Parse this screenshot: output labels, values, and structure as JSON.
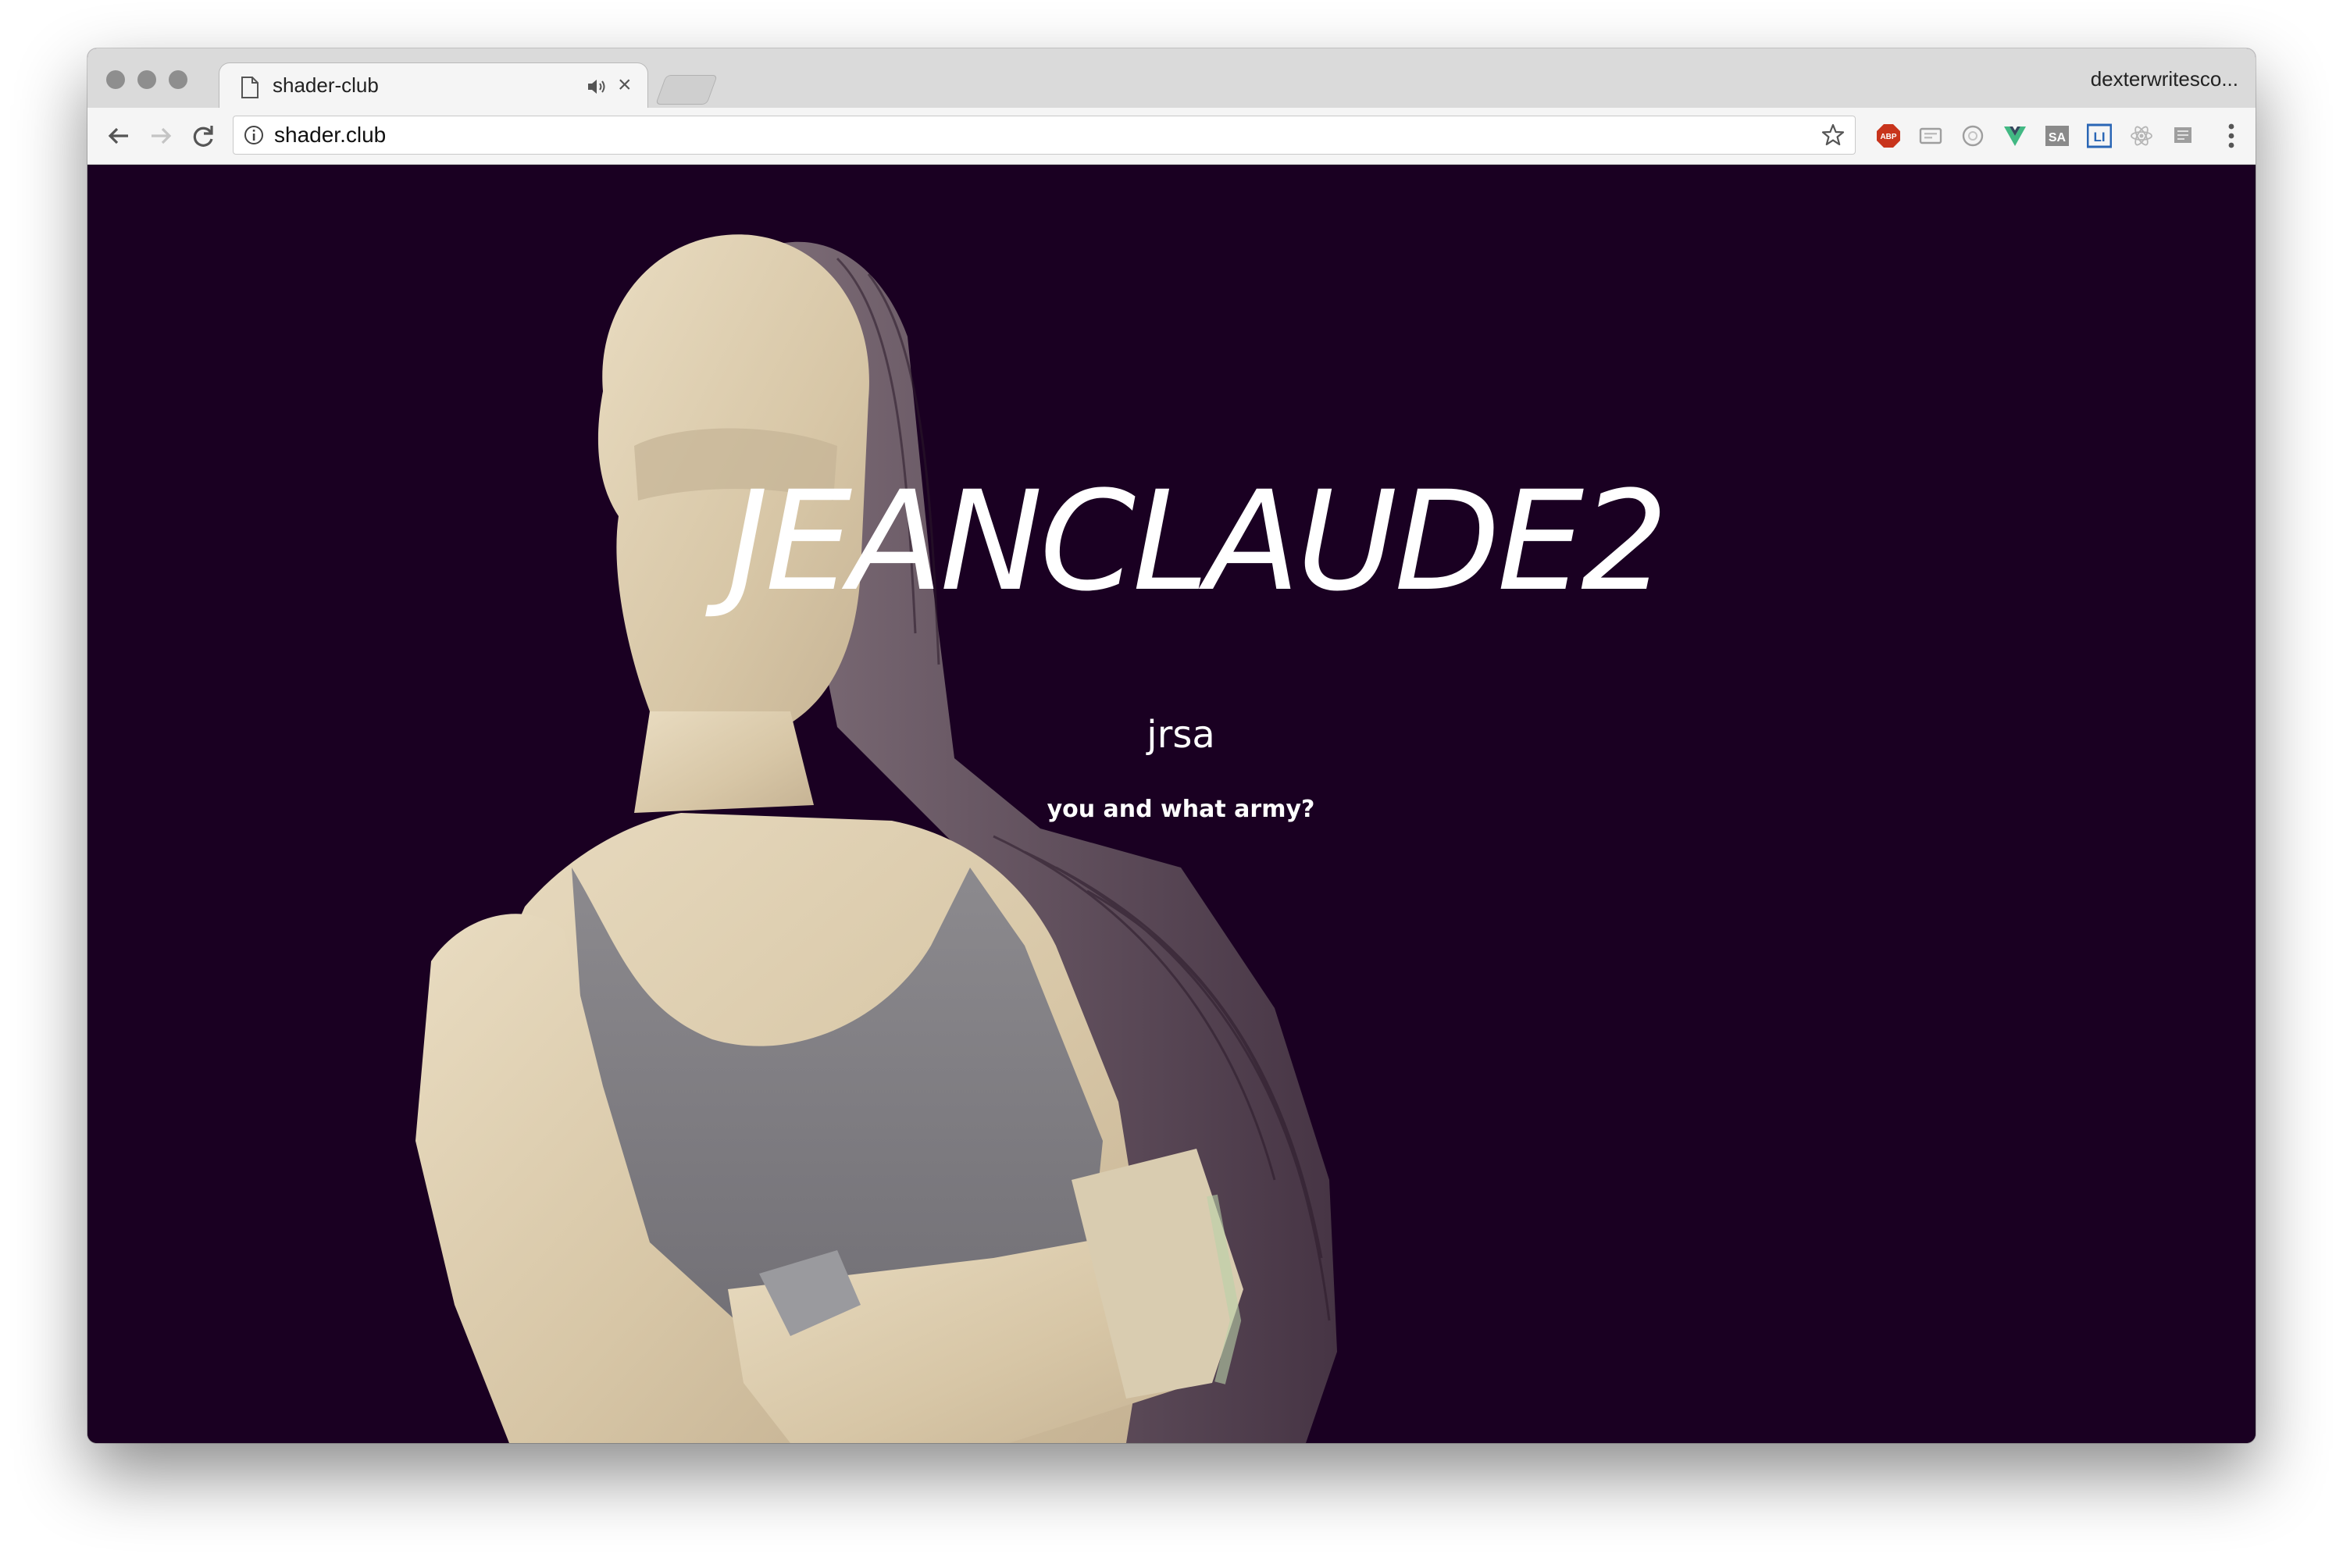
{
  "browser": {
    "tab": {
      "title": "shader-club"
    },
    "profile_name": "dexterwritesco...",
    "address_bar": {
      "url": "shader.club"
    },
    "extensions": [
      {
        "name": "adblock-plus-icon",
        "label": "ABP",
        "color": "#c8341c"
      },
      {
        "name": "cast-icon",
        "color": "#9e9e9e"
      },
      {
        "name": "circle-extension-icon",
        "color": "#9e9e9e"
      },
      {
        "name": "vue-devtools-icon",
        "color": "#41b883"
      },
      {
        "name": "sa-extension-icon",
        "label": "SA",
        "color": "#8a8a8a"
      },
      {
        "name": "li-extension-icon",
        "label": "LI",
        "color": "#2a66b5"
      },
      {
        "name": "react-devtools-icon",
        "color": "#b5b5b5"
      },
      {
        "name": "notes-extension-icon",
        "color": "#9e9e9e"
      }
    ]
  },
  "page": {
    "background_color": "#1a0022",
    "headline": "JEANCLAUDE2",
    "author": "jrsa",
    "tagline": "you and what army?"
  }
}
